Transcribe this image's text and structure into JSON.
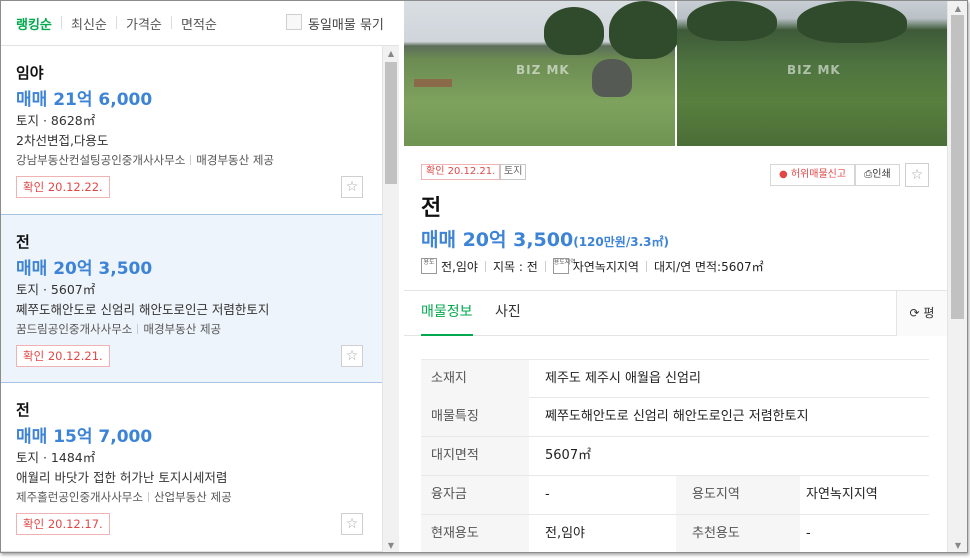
{
  "sort": {
    "options": [
      "랭킹순",
      "최신순",
      "가격순",
      "면적순"
    ],
    "same_listing_label": "동일매물 묶기"
  },
  "listings": [
    {
      "title": "임야",
      "price": "매매 21억 6,000",
      "spec": "토지 · 8628㎡",
      "desc": "2차선변접,다용도",
      "agent": "강남부동산컨설팅공인중개사사무소",
      "provider": "매경부동산 제공",
      "confirmed": "확인 20.12.22."
    },
    {
      "title": "전",
      "price": "매매 20억 3,500",
      "spec": "토지 · 5607㎡",
      "desc": "쩨쭈도해안도로 신엄리 해안도로인근 저렴한토지",
      "agent": "꿈드림공인중개사사무소",
      "provider": "매경부동산 제공",
      "confirmed": "확인 20.12.21."
    },
    {
      "title": "전",
      "price": "매매 15억 7,000",
      "spec": "토지 · 1484㎡",
      "desc": "애월리 바닷가 접한 허가난 토지시세저렴",
      "agent": "제주홀런공인중개사사무소",
      "provider": "산업부동산 제공",
      "confirmed": "확인 20.12.17."
    }
  ],
  "photos": {
    "watermark": "BIZ MK"
  },
  "detail": {
    "confirmed": "확인 20.12.21.",
    "type_badge": "토지",
    "report_label": "허위매물신고",
    "print_label": "인쇄",
    "title": "전",
    "price": "매매 20억 3,500",
    "unit_price": "(120만원/3.3㎡)",
    "meta": {
      "icon1": "용도",
      "land": "전,임야",
      "jimok": "지목 : 전",
      "icon2": "용도지역",
      "zone": "자연녹지지역",
      "area": "대지/연 면적:5607㎡"
    },
    "tabs": [
      "매물정보",
      "사진"
    ],
    "unit_toggle": "평",
    "table": {
      "location_label": "소재지",
      "location": "제주도 제주시 애월읍 신엄리",
      "feature_label": "매물특징",
      "feature": "쩨쭈도해안도로 신엄리 해안도로인근 저렴한토지",
      "area_label": "대지면적",
      "area": "5607㎡",
      "loan_label": "융자금",
      "loan": "-",
      "zone_label": "용도지역",
      "zone": "자연녹지지역",
      "use_label": "현재용도",
      "use": "전,임야",
      "rec_label": "추천용도",
      "rec": "-"
    }
  },
  "colors": {
    "accent_green": "#03a94e",
    "price_blue": "#3d83d6",
    "badge_red": "#e04848"
  }
}
